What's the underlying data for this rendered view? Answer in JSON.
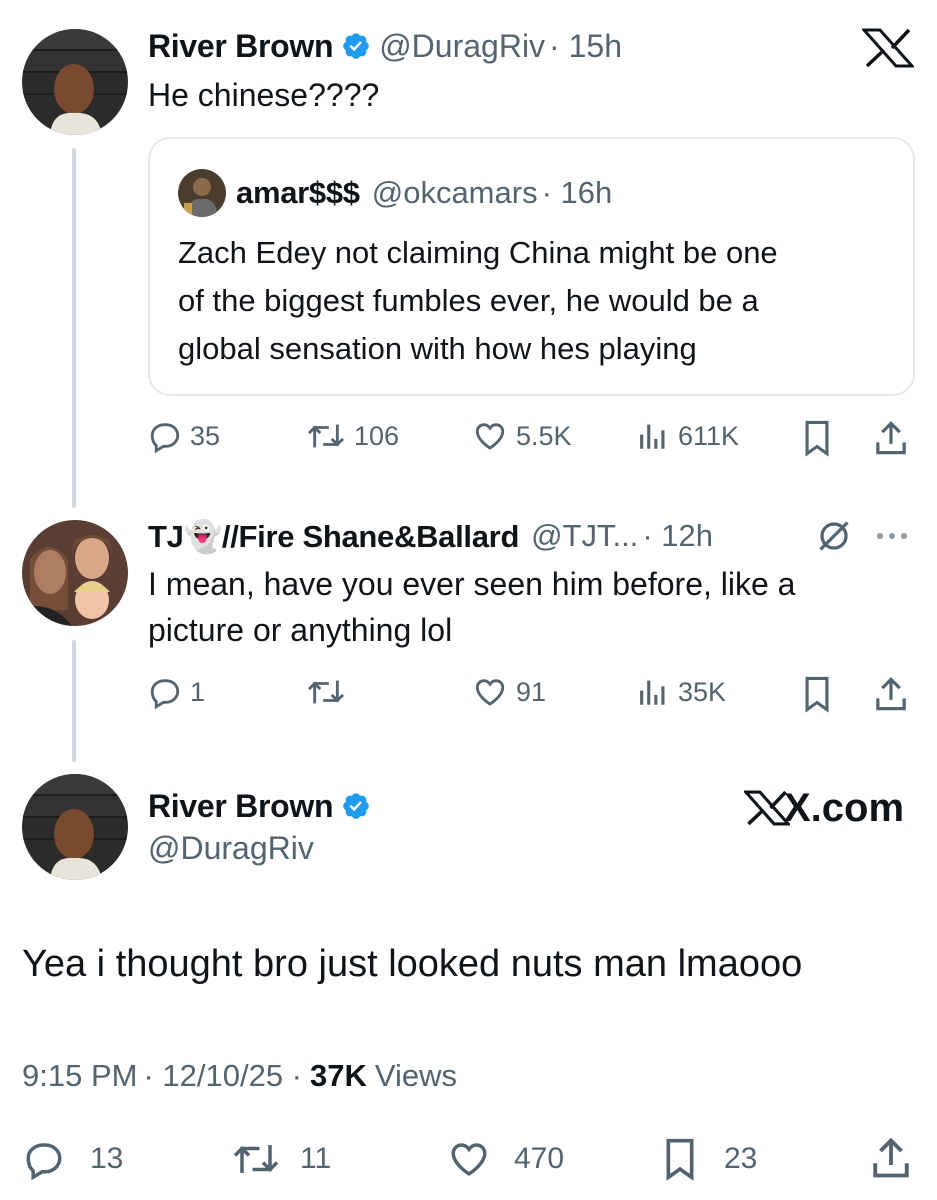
{
  "tweet1": {
    "name": "River Brown",
    "handle": "@DuragRiv",
    "time": "· 15h",
    "text": "He chinese????",
    "quote": {
      "name": "amar$$$",
      "handle": "@okcamars",
      "time": "· 16h",
      "text_lines": [
        "Zach Edey not claiming China might be one",
        "of the biggest fumbles ever, he would be a",
        "global sensation with how hes playing"
      ]
    },
    "actions": {
      "replies": "35",
      "reposts": "106",
      "likes": "5.5K",
      "views": "611K"
    }
  },
  "tweet2": {
    "name": "TJ👻//Fire Shane&Ballard",
    "handle": "@TJT...",
    "time": "· 12h",
    "text_lines": [
      "I mean, have you ever seen him before, like a",
      "picture or anything lol"
    ],
    "actions": {
      "replies": "1",
      "reposts": "",
      "likes": "91",
      "views": "35K"
    }
  },
  "tweet3": {
    "name": "River Brown",
    "handle": "@DuragRiv",
    "brand": "X.com",
    "text": "Yea i thought bro just looked nuts man lmaooo",
    "meta": {
      "time": "9:15 PM",
      "date": "· 12/10/25 ·",
      "views_count": "37K",
      "views_label": "Views"
    },
    "actions": {
      "replies": "13",
      "reposts": "11",
      "likes": "470",
      "bookmarks": "23"
    }
  },
  "colors": {
    "verified": "#1d9bf0",
    "text": "#0f1419",
    "muted": "#536471",
    "border": "#e4e9ec"
  },
  "icons": [
    "x-logo-icon",
    "verified-icon",
    "reply-icon",
    "repost-icon",
    "like-icon",
    "views-icon",
    "bookmark-icon",
    "share-icon",
    "grok-icon",
    "more-icon"
  ]
}
